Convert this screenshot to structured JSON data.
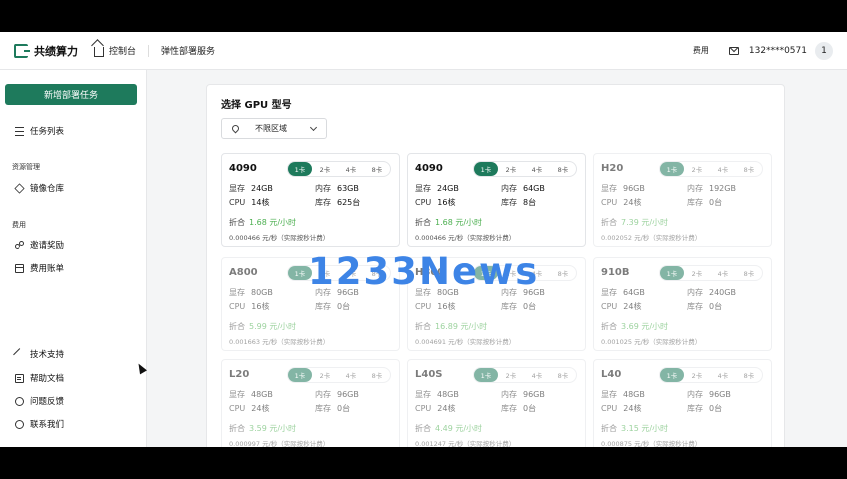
{
  "brand": {
    "name": "共绩算力"
  },
  "topnav": {
    "home": "控制台",
    "service": "弹性部署服务"
  },
  "topright": {
    "fee": "费用",
    "phone": "132****0571",
    "avatar": "1"
  },
  "sidebar": {
    "new_button": "新增部署任务",
    "task_list": "任务列表",
    "group_resource": "资源管理",
    "image_repo": "镜像仓库",
    "group_fee": "费用",
    "invite": "邀请奖励",
    "bill": "费用账单",
    "tech": "技术支持",
    "docs": "帮助文档",
    "feedback": "问题反馈",
    "contact": "联系我们"
  },
  "panel": {
    "title": "选择 GPU 型号",
    "region": "不限区域"
  },
  "labels": {
    "mem": "显存",
    "ram": "内存",
    "cpu": "CPU",
    "stock": "库存",
    "price": "折合",
    "sub_suffix": "元/秒（实际按秒计费）",
    "pills": [
      "1卡",
      "2卡",
      "4卡",
      "8卡"
    ]
  },
  "cards": [
    {
      "name": "4090",
      "mem": "24GB",
      "ram": "63GB",
      "cpu": "14核",
      "stock": "625台",
      "price": "1.68 元/小时",
      "sub": "0.000466"
    },
    {
      "name": "4090",
      "mem": "24GB",
      "ram": "64GB",
      "cpu": "16核",
      "stock": "8台",
      "price": "1.68 元/小时",
      "sub": "0.000466"
    },
    {
      "name": "H20",
      "mem": "96GB",
      "ram": "192GB",
      "cpu": "24核",
      "stock": "0台",
      "price": "7.39 元/小时",
      "sub": "0.002052"
    },
    {
      "name": "A800",
      "mem": "80GB",
      "ram": "96GB",
      "cpu": "16核",
      "stock": "0台",
      "price": "5.99 元/小时",
      "sub": "0.001663"
    },
    {
      "name": "H800",
      "mem": "80GB",
      "ram": "96GB",
      "cpu": "16核",
      "stock": "0台",
      "price": "16.89 元/小时",
      "sub": "0.004691"
    },
    {
      "name": "910B",
      "mem": "64GB",
      "ram": "240GB",
      "cpu": "24核",
      "stock": "0台",
      "price": "3.69 元/小时",
      "sub": "0.001025"
    },
    {
      "name": "L20",
      "mem": "48GB",
      "ram": "96GB",
      "cpu": "24核",
      "stock": "0台",
      "price": "3.59 元/小时",
      "sub": "0.000997"
    },
    {
      "name": "L40S",
      "mem": "48GB",
      "ram": "96GB",
      "cpu": "24核",
      "stock": "0台",
      "price": "4.49 元/小时",
      "sub": "0.001247"
    },
    {
      "name": "L40",
      "mem": "48GB",
      "ram": "96GB",
      "cpu": "24核",
      "stock": "0台",
      "price": "3.15 元/小时",
      "sub": "0.000875"
    }
  ],
  "watermark": "1233News",
  "colors": {
    "accent": "#1e7a5c",
    "price_green": "#4caf50",
    "watermark": "#3d84e6"
  }
}
